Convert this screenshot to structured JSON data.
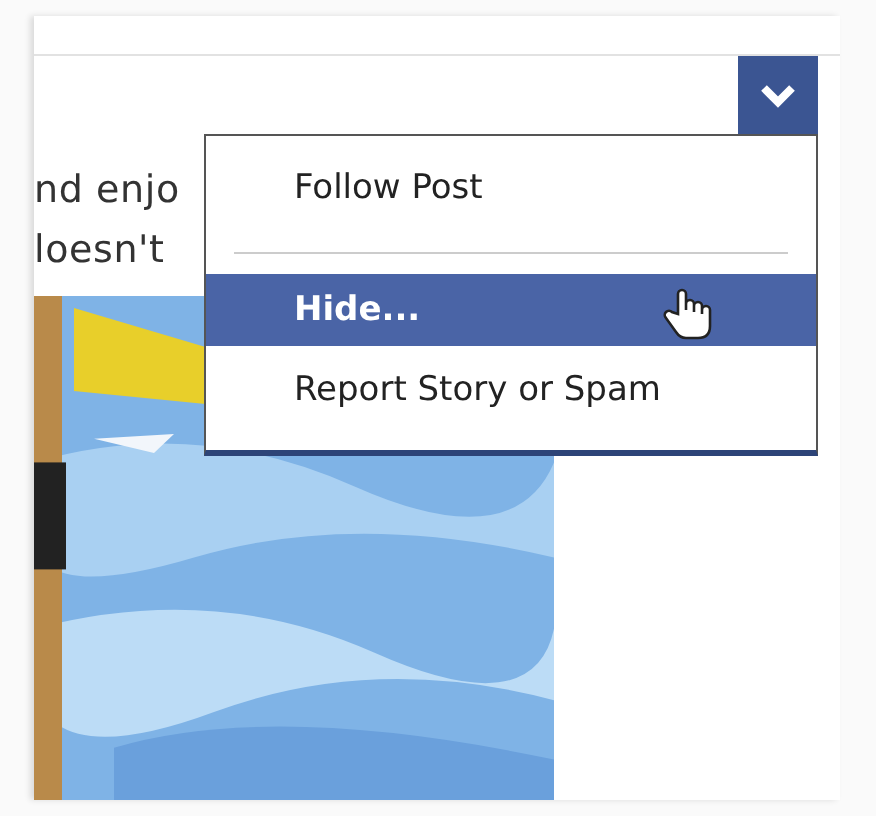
{
  "post": {
    "text_lines": [
      "nd enjo",
      "loesn't"
    ],
    "picture": {
      "kind": "picture"
    }
  },
  "menu_button": {
    "expanded": true
  },
  "menu": {
    "items": [
      {
        "label": "Follow Post",
        "selected": false,
        "separated": false
      },
      {
        "label": "Hide...",
        "selected": true,
        "separated": true
      },
      {
        "label": "Report Story or Spam",
        "selected": false,
        "separated": false
      }
    ]
  }
}
